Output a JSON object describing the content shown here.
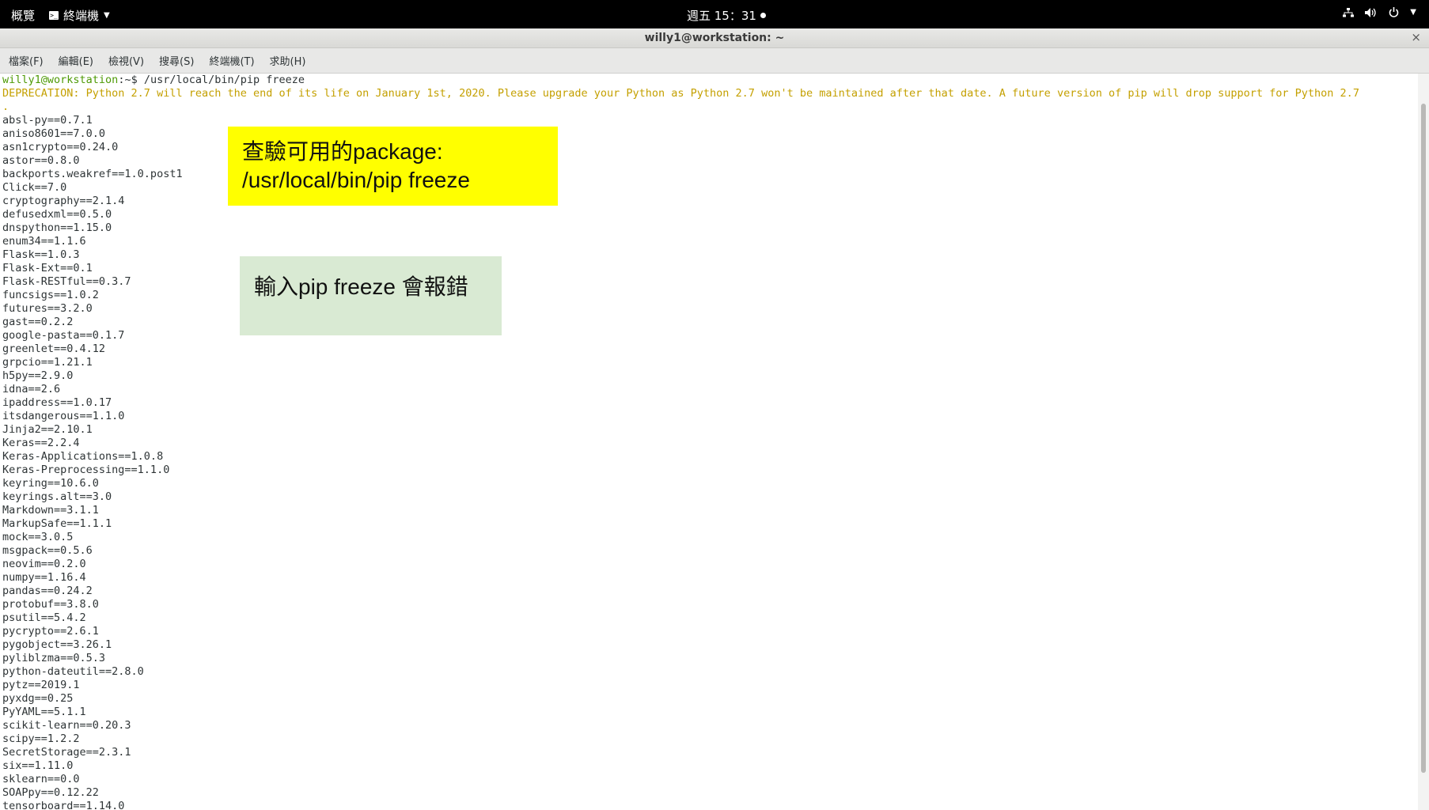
{
  "topbar": {
    "overview": "概覽",
    "app_name": "終端機",
    "clock": "週五 15：31",
    "icons": [
      "network-icon",
      "volume-icon",
      "power-icon",
      "chevron-down-icon"
    ]
  },
  "window": {
    "title": "willy1@workstation: ~",
    "close_glyph": "×"
  },
  "menu": [
    "檔案(F)",
    "編輯(E)",
    "檢視(V)",
    "搜尋(S)",
    "終端機(T)",
    "求助(H)"
  ],
  "terminal": {
    "prompt_user": "willy1@workstation",
    "prompt_rest": ":~$ /usr/local/bin/pip freeze",
    "warning_line1": "DEPRECATION: Python 2.7 will reach the end of its life on January 1st, 2020. Please upgrade your Python as Python 2.7 won't be maintained after that date. A future version of pip will drop support for Python 2.7",
    "warning_line2": ".",
    "packages": [
      "absl-py==0.7.1",
      "aniso8601==7.0.0",
      "asn1crypto==0.24.0",
      "astor==0.8.0",
      "backports.weakref==1.0.post1",
      "Click==7.0",
      "cryptography==2.1.4",
      "defusedxml==0.5.0",
      "dnspython==1.15.0",
      "enum34==1.1.6",
      "Flask==1.0.3",
      "Flask-Ext==0.1",
      "Flask-RESTful==0.3.7",
      "funcsigs==1.0.2",
      "futures==3.2.0",
      "gast==0.2.2",
      "google-pasta==0.1.7",
      "greenlet==0.4.12",
      "grpcio==1.21.1",
      "h5py==2.9.0",
      "idna==2.6",
      "ipaddress==1.0.17",
      "itsdangerous==1.1.0",
      "Jinja2==2.10.1",
      "Keras==2.2.4",
      "Keras-Applications==1.0.8",
      "Keras-Preprocessing==1.1.0",
      "keyring==10.6.0",
      "keyrings.alt==3.0",
      "Markdown==3.1.1",
      "MarkupSafe==1.1.1",
      "mock==3.0.5",
      "msgpack==0.5.6",
      "neovim==0.2.0",
      "numpy==1.16.4",
      "pandas==0.24.2",
      "protobuf==3.8.0",
      "psutil==5.4.2",
      "pycrypto==2.6.1",
      "pygobject==3.26.1",
      "pyliblzma==0.5.3",
      "python-dateutil==2.8.0",
      "pytz==2019.1",
      "pyxdg==0.25",
      "PyYAML==5.1.1",
      "scikit-learn==0.20.3",
      "scipy==1.2.2",
      "SecretStorage==2.3.1",
      "six==1.11.0",
      "sklearn==0.0",
      "SOAPpy==0.12.22",
      "tensorboard==1.14.0"
    ]
  },
  "notes": {
    "yellow_line1": "查驗可用的package:",
    "yellow_line2": "/usr/local/bin/pip freeze",
    "green": "輸入pip freeze 會報錯"
  },
  "colors": {
    "prompt_green": "#4e9a06",
    "warning_yellow": "#c4a000",
    "note_yellow": "#ffff00",
    "note_green": "#d9ead3"
  }
}
